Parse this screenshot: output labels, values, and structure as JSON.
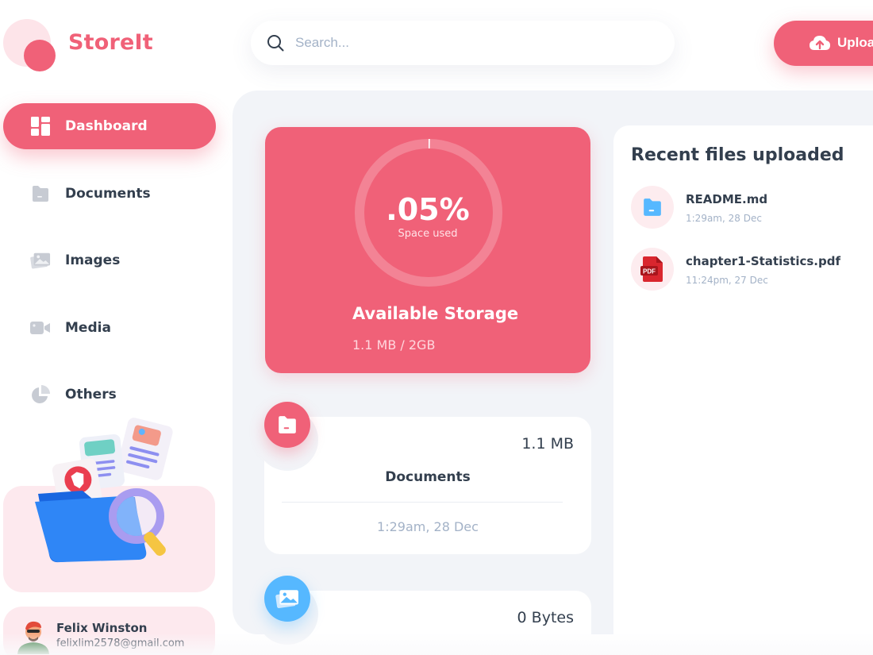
{
  "app": {
    "name": "StoreIt",
    "accent_color": "#f06178",
    "blue_color": "#56b8ff"
  },
  "sidebar": {
    "items": [
      {
        "label": "Dashboard",
        "icon": "dashboard-icon",
        "active": true
      },
      {
        "label": "Documents",
        "icon": "document-folder-icon",
        "active": false
      },
      {
        "label": "Images",
        "icon": "image-icon",
        "active": false
      },
      {
        "label": "Media",
        "icon": "video-camera-icon",
        "active": false
      },
      {
        "label": "Others",
        "icon": "pie-chart-icon",
        "active": false
      }
    ],
    "user": {
      "name": "Felix Winston",
      "email": "felixlim2578@gmail.com"
    }
  },
  "header": {
    "search": {
      "placeholder": "Search...",
      "value": ""
    },
    "upload_label": "Upload"
  },
  "storage": {
    "percent_label": ".05%",
    "percent_used": 0.05,
    "subtitle": "Space used",
    "title": "Available Storage",
    "usage": "1.1 MB / 2GB"
  },
  "summaries": [
    {
      "title": "Documents",
      "size": "1.1 MB",
      "date": "1:29am, 28 Dec",
      "icon": "document-folder-icon"
    },
    {
      "size": "0 Bytes",
      "icon": "image-icon"
    }
  ],
  "recent": {
    "title": "Recent files uploaded",
    "files": [
      {
        "name": "README.md",
        "date": "1:29am, 28 Dec",
        "icon": "document-folder-icon"
      },
      {
        "name": "chapter1-Statistics.pdf",
        "date": "11:24pm, 27 Dec",
        "icon": "pdf-icon",
        "badge": "PDF"
      }
    ]
  }
}
